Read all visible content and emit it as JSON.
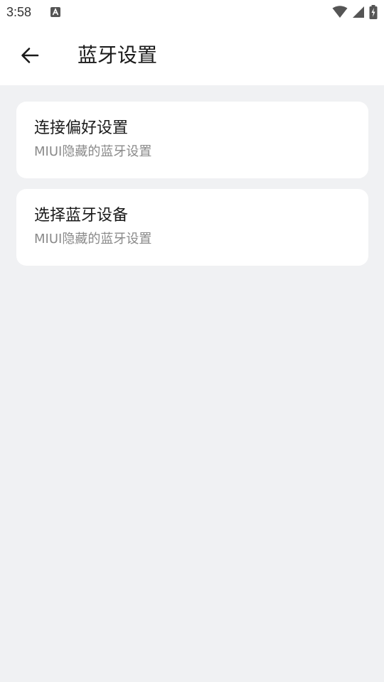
{
  "status_bar": {
    "time": "3:58",
    "notification_icon": "a-box-icon",
    "wifi_icon": "wifi-icon",
    "signal_icon": "cellular-signal-icon",
    "battery_icon": "battery-charging-icon"
  },
  "app_bar": {
    "back_icon": "arrow-left-icon",
    "title": "蓝牙设置"
  },
  "items": [
    {
      "title": "连接偏好设置",
      "subtitle": "MIUI隐藏的蓝牙设置"
    },
    {
      "title": "选择蓝牙设备",
      "subtitle": "MIUI隐藏的蓝牙设置"
    }
  ],
  "colors": {
    "background": "#f0f1f3",
    "surface": "#ffffff",
    "primary_text": "#1a1a1a",
    "secondary_text": "#8a8a8a"
  }
}
